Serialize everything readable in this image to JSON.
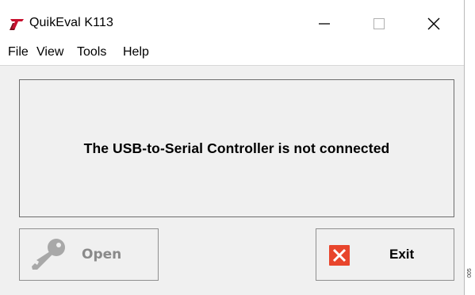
{
  "window": {
    "title": "QuikEval K113",
    "controls": {
      "minimize": "—",
      "maximize": "☐",
      "close": "✕"
    }
  },
  "menu": {
    "items": [
      "File",
      "View",
      "Tools",
      "Help"
    ]
  },
  "status": {
    "message": "The USB-to-Serial Controller is not connected"
  },
  "buttons": {
    "open": {
      "label": "Open",
      "icon": "key-icon",
      "enabled": false
    },
    "exit": {
      "label": "Exit",
      "icon": "close-x-icon",
      "enabled": true
    }
  },
  "figure_code": "005",
  "colors": {
    "brand_red": "#c8102e",
    "exit_red": "#e8452c",
    "disabled_gray": "#8a8a8a"
  }
}
